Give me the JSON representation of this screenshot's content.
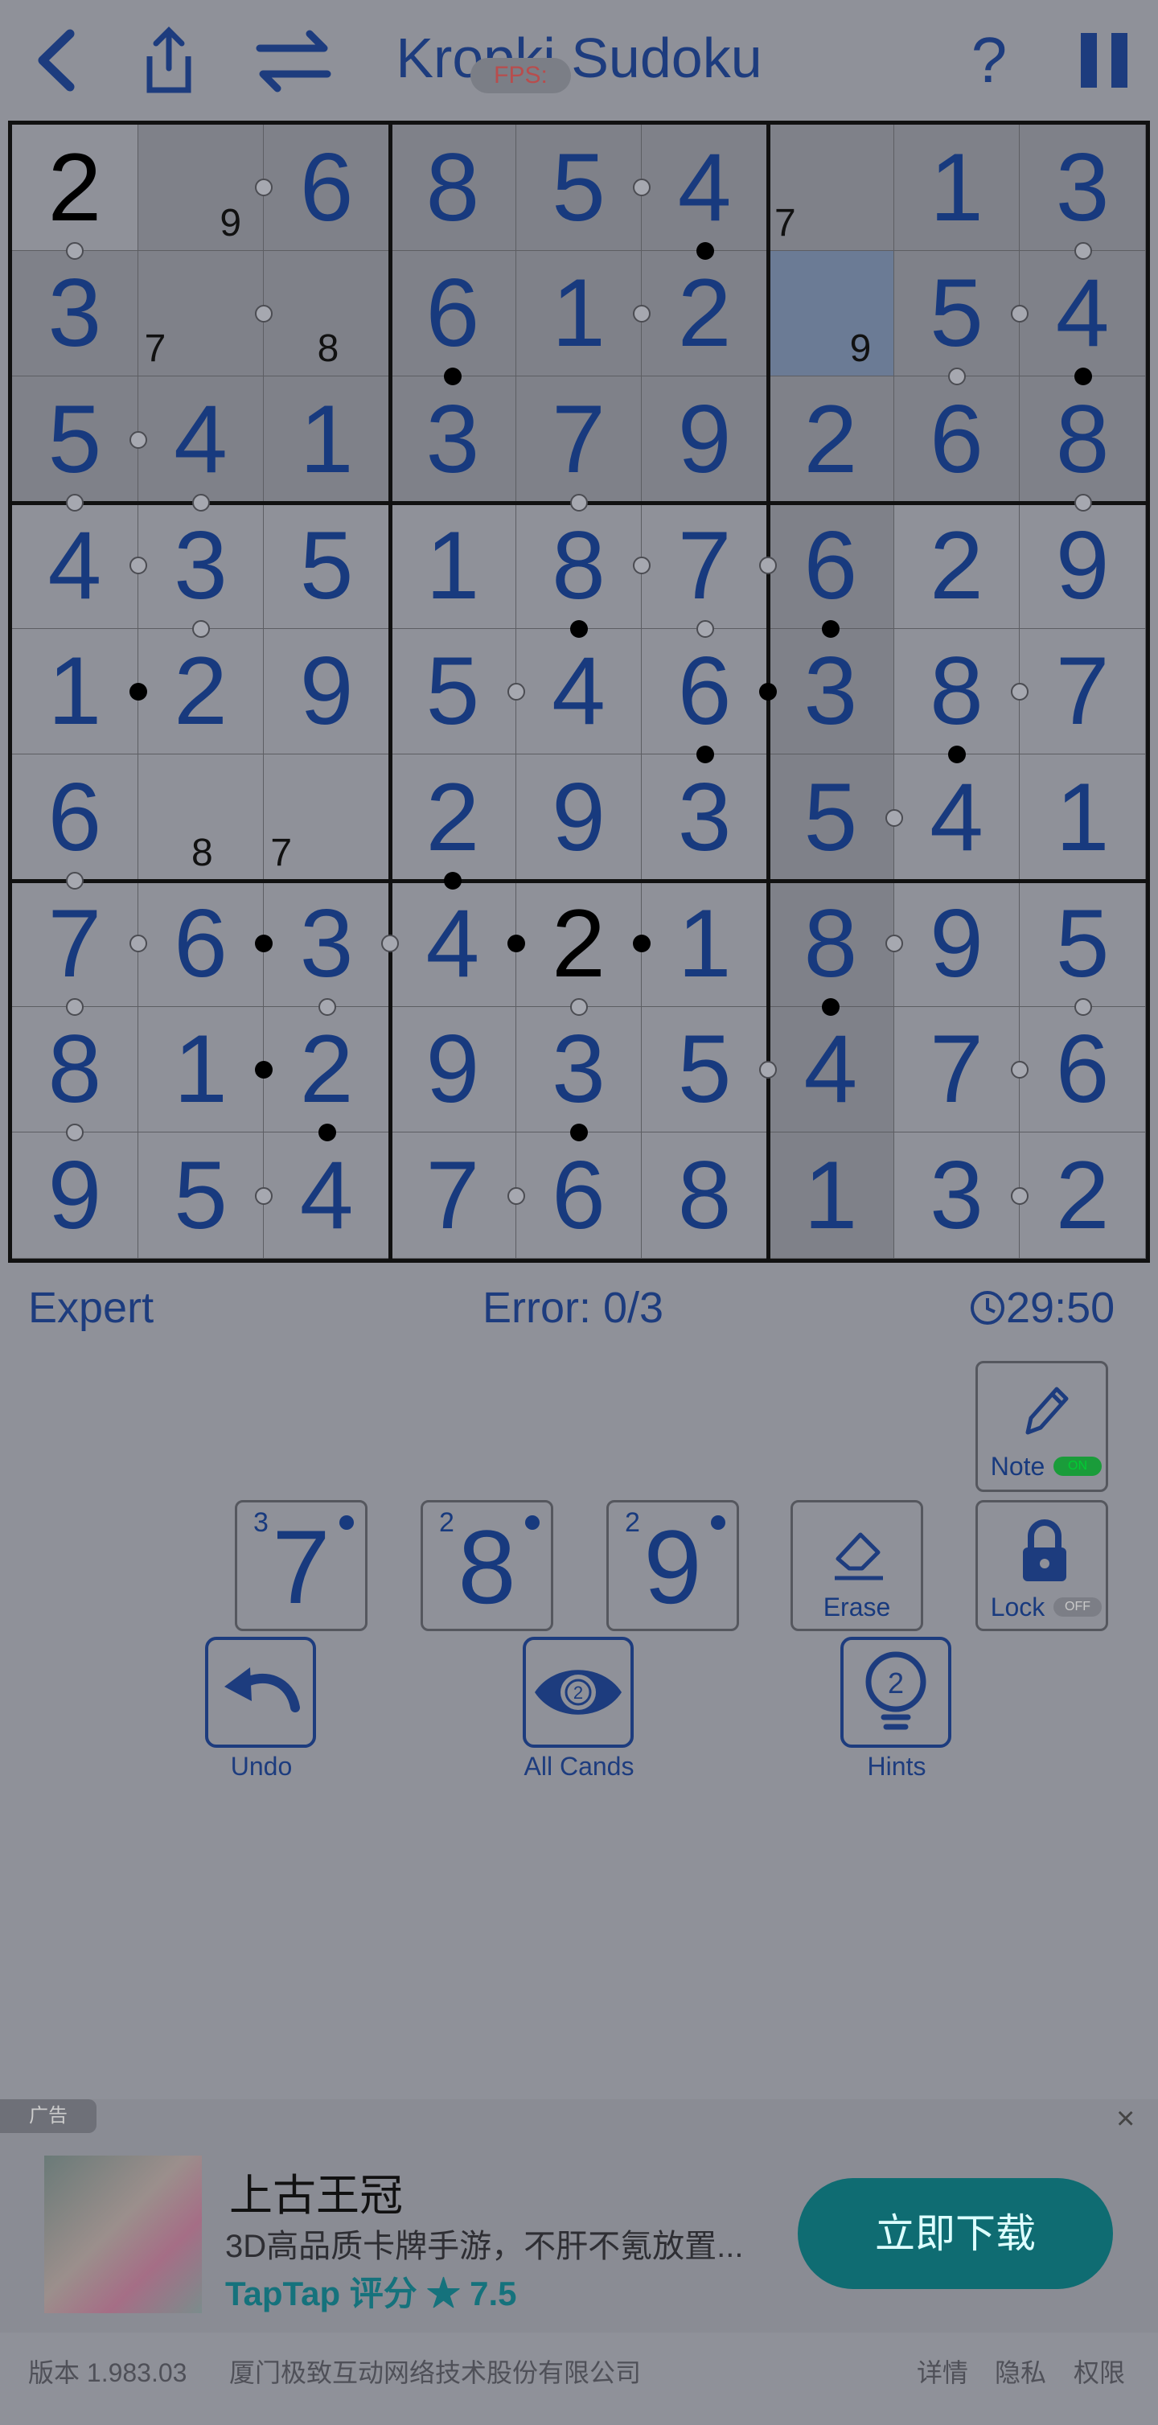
{
  "header": {
    "title": "Kropki Sudoku",
    "fps_badge": "FPS:"
  },
  "board": {
    "values": [
      [
        2,
        0,
        6,
        8,
        5,
        4,
        0,
        1,
        3
      ],
      [
        3,
        0,
        0,
        6,
        1,
        2,
        0,
        5,
        4
      ],
      [
        5,
        4,
        1,
        3,
        7,
        9,
        2,
        6,
        8
      ],
      [
        4,
        3,
        5,
        1,
        8,
        7,
        6,
        2,
        9
      ],
      [
        1,
        2,
        9,
        5,
        4,
        6,
        3,
        8,
        7
      ],
      [
        6,
        0,
        0,
        2,
        9,
        3,
        5,
        4,
        1
      ],
      [
        7,
        6,
        3,
        4,
        2,
        1,
        8,
        9,
        5
      ],
      [
        8,
        1,
        2,
        9,
        3,
        5,
        4,
        7,
        6
      ],
      [
        9,
        5,
        4,
        7,
        6,
        8,
        1,
        3,
        2
      ]
    ],
    "given_cells": [
      [
        0,
        0
      ],
      [
        6,
        4
      ]
    ],
    "selected_cell": [
      1,
      6
    ],
    "shaded_cells": [
      [
        0,
        1
      ],
      [
        0,
        2
      ],
      [
        0,
        3
      ],
      [
        0,
        4
      ],
      [
        0,
        5
      ],
      [
        0,
        6
      ],
      [
        0,
        7
      ],
      [
        0,
        8
      ],
      [
        1,
        0
      ],
      [
        1,
        1
      ],
      [
        1,
        2
      ],
      [
        1,
        3
      ],
      [
        1,
        4
      ],
      [
        1,
        5
      ],
      [
        1,
        7
      ],
      [
        1,
        8
      ],
      [
        2,
        0
      ],
      [
        2,
        1
      ],
      [
        2,
        2
      ],
      [
        2,
        3
      ],
      [
        2,
        4
      ],
      [
        2,
        5
      ],
      [
        2,
        6
      ],
      [
        2,
        7
      ],
      [
        2,
        8
      ],
      [
        3,
        6
      ],
      [
        4,
        6
      ],
      [
        5,
        6
      ],
      [
        6,
        6
      ],
      [
        7,
        6
      ],
      [
        8,
        6
      ]
    ],
    "notes": [
      {
        "cell": [
          0,
          1
        ],
        "text": "9",
        "pos": "br"
      },
      {
        "cell": [
          0,
          6
        ],
        "text": "7",
        "pos": "bl"
      },
      {
        "cell": [
          1,
          1
        ],
        "text": "7",
        "pos": "bl"
      },
      {
        "cell": [
          1,
          2
        ],
        "text": "8",
        "pos": "bc"
      },
      {
        "cell": [
          1,
          6
        ],
        "text": "9",
        "pos": "br"
      },
      {
        "cell": [
          5,
          1
        ],
        "text": "8",
        "pos": "bc"
      },
      {
        "cell": [
          5,
          2
        ],
        "text": "7",
        "pos": "bl"
      }
    ],
    "h_dots": [
      {
        "r": 0,
        "c": 1,
        "t": "w"
      },
      {
        "r": 0,
        "c": 4,
        "t": "w"
      },
      {
        "r": 1,
        "c": 1,
        "t": "w"
      },
      {
        "r": 1,
        "c": 4,
        "t": "w"
      },
      {
        "r": 1,
        "c": 7,
        "t": "w"
      },
      {
        "r": 2,
        "c": 0,
        "t": "w"
      },
      {
        "r": 3,
        "c": 0,
        "t": "w"
      },
      {
        "r": 3,
        "c": 4,
        "t": "w"
      },
      {
        "r": 3,
        "c": 5,
        "t": "w"
      },
      {
        "r": 4,
        "c": 0,
        "t": "b"
      },
      {
        "r": 4,
        "c": 3,
        "t": "w"
      },
      {
        "r": 4,
        "c": 5,
        "t": "b"
      },
      {
        "r": 4,
        "c": 7,
        "t": "w"
      },
      {
        "r": 5,
        "c": 6,
        "t": "w"
      },
      {
        "r": 6,
        "c": 0,
        "t": "w"
      },
      {
        "r": 6,
        "c": 1,
        "t": "b"
      },
      {
        "r": 6,
        "c": 2,
        "t": "w"
      },
      {
        "r": 6,
        "c": 3,
        "t": "b"
      },
      {
        "r": 6,
        "c": 4,
        "t": "b"
      },
      {
        "r": 6,
        "c": 6,
        "t": "w"
      },
      {
        "r": 7,
        "c": 1,
        "t": "b"
      },
      {
        "r": 7,
        "c": 5,
        "t": "w"
      },
      {
        "r": 7,
        "c": 7,
        "t": "w"
      },
      {
        "r": 8,
        "c": 1,
        "t": "w"
      },
      {
        "r": 8,
        "c": 3,
        "t": "w"
      },
      {
        "r": 8,
        "c": 7,
        "t": "w"
      }
    ],
    "v_dots": [
      {
        "r": 0,
        "c": 0,
        "t": "w"
      },
      {
        "r": 0,
        "c": 5,
        "t": "b"
      },
      {
        "r": 0,
        "c": 8,
        "t": "w"
      },
      {
        "r": 1,
        "c": 3,
        "t": "b"
      },
      {
        "r": 1,
        "c": 7,
        "t": "w"
      },
      {
        "r": 1,
        "c": 8,
        "t": "b"
      },
      {
        "r": 2,
        "c": 0,
        "t": "w"
      },
      {
        "r": 2,
        "c": 1,
        "t": "w"
      },
      {
        "r": 2,
        "c": 4,
        "t": "w"
      },
      {
        "r": 2,
        "c": 8,
        "t": "w"
      },
      {
        "r": 3,
        "c": 1,
        "t": "w"
      },
      {
        "r": 3,
        "c": 4,
        "t": "b"
      },
      {
        "r": 3,
        "c": 5,
        "t": "w"
      },
      {
        "r": 3,
        "c": 6,
        "t": "b"
      },
      {
        "r": 4,
        "c": 5,
        "t": "b"
      },
      {
        "r": 4,
        "c": 7,
        "t": "b"
      },
      {
        "r": 5,
        "c": 0,
        "t": "w"
      },
      {
        "r": 5,
        "c": 3,
        "t": "b"
      },
      {
        "r": 6,
        "c": 0,
        "t": "w"
      },
      {
        "r": 6,
        "c": 2,
        "t": "w"
      },
      {
        "r": 6,
        "c": 4,
        "t": "w"
      },
      {
        "r": 6,
        "c": 6,
        "t": "b"
      },
      {
        "r": 6,
        "c": 8,
        "t": "w"
      },
      {
        "r": 7,
        "c": 0,
        "t": "w"
      },
      {
        "r": 7,
        "c": 2,
        "t": "b"
      },
      {
        "r": 7,
        "c": 4,
        "t": "b"
      }
    ]
  },
  "status": {
    "difficulty": "Expert",
    "errors": "Error: 0/3",
    "timer": "29:50"
  },
  "controls": {
    "note_label": "Note",
    "note_toggle": "ON",
    "lock_label": "Lock",
    "lock_toggle": "OFF",
    "erase_label": "Erase",
    "number_buttons": [
      {
        "digit": "7",
        "count": "3"
      },
      {
        "digit": "8",
        "count": "2"
      },
      {
        "digit": "9",
        "count": "2"
      }
    ],
    "undo_label": "Undo",
    "all_cands_label": "All Cands",
    "all_cands_badge": "2",
    "hints_label": "Hints",
    "hints_badge": "2"
  },
  "ad": {
    "tag": "广告",
    "title": "上古王冠",
    "description": "3D高品质卡牌手游，不肝不氪放置...",
    "rating_brand": "TapTap",
    "rating_text": "评分 ★ 7.5",
    "cta": "立即下载",
    "close": "×"
  },
  "footer": {
    "version": "版本 1.983.03",
    "company": "厦门极致互动网络技术股份有限公司",
    "details": "详情",
    "privacy": "隐私",
    "permissions": "权限"
  },
  "colors": {
    "accent": "#1d3c7e",
    "digit": "#183a7e",
    "background": "#8f9199",
    "selected": "#6b7b95",
    "shaded": "#7f8189"
  }
}
